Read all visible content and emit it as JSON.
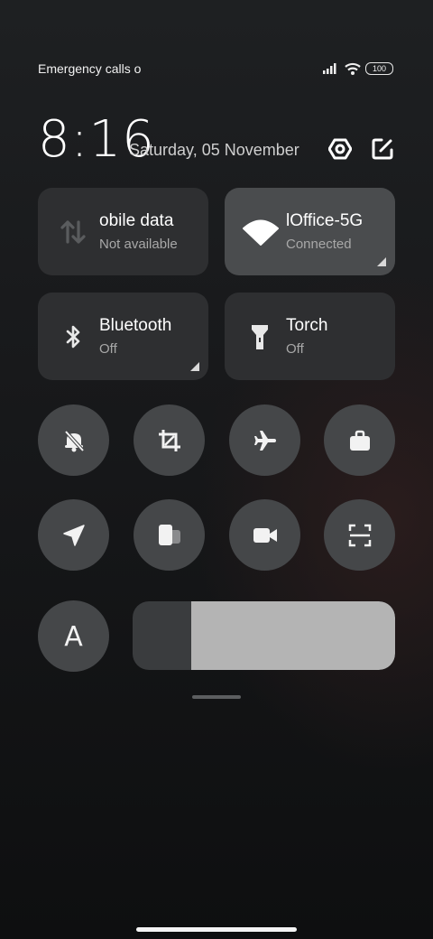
{
  "status_bar": {
    "carrier_text": "Emergency calls o",
    "battery": "100"
  },
  "header": {
    "time": "8:16",
    "date": "Saturday, 05 November"
  },
  "tiles": [
    {
      "title": "obile data",
      "subtitle": "Not available",
      "icon": "mobile-data-icon",
      "active": false
    },
    {
      "title": "lOffice-5G",
      "subtitle": "Connected",
      "icon": "wifi-icon",
      "active": true
    },
    {
      "title": "Bluetooth",
      "subtitle": "Off",
      "icon": "bluetooth-icon",
      "active": false
    },
    {
      "title": "Torch",
      "subtitle": "Off",
      "icon": "torch-icon",
      "active": false
    }
  ],
  "toggles_row1": [
    "mute-icon",
    "screenshot-icon",
    "airplane-icon",
    "work-profile-icon"
  ],
  "toggles_row2": [
    "location-icon",
    "floating-window-icon",
    "screen-recorder-icon",
    "scanner-icon"
  ],
  "auto_brightness": {
    "label": "A"
  },
  "brightness": {
    "level": 0.22
  },
  "colors": {
    "tile_active": "#4a4c4e",
    "tile_inactive": "#2e2f31",
    "toggle_bg": "#454749",
    "slider_fill": "#b4b4b4"
  }
}
